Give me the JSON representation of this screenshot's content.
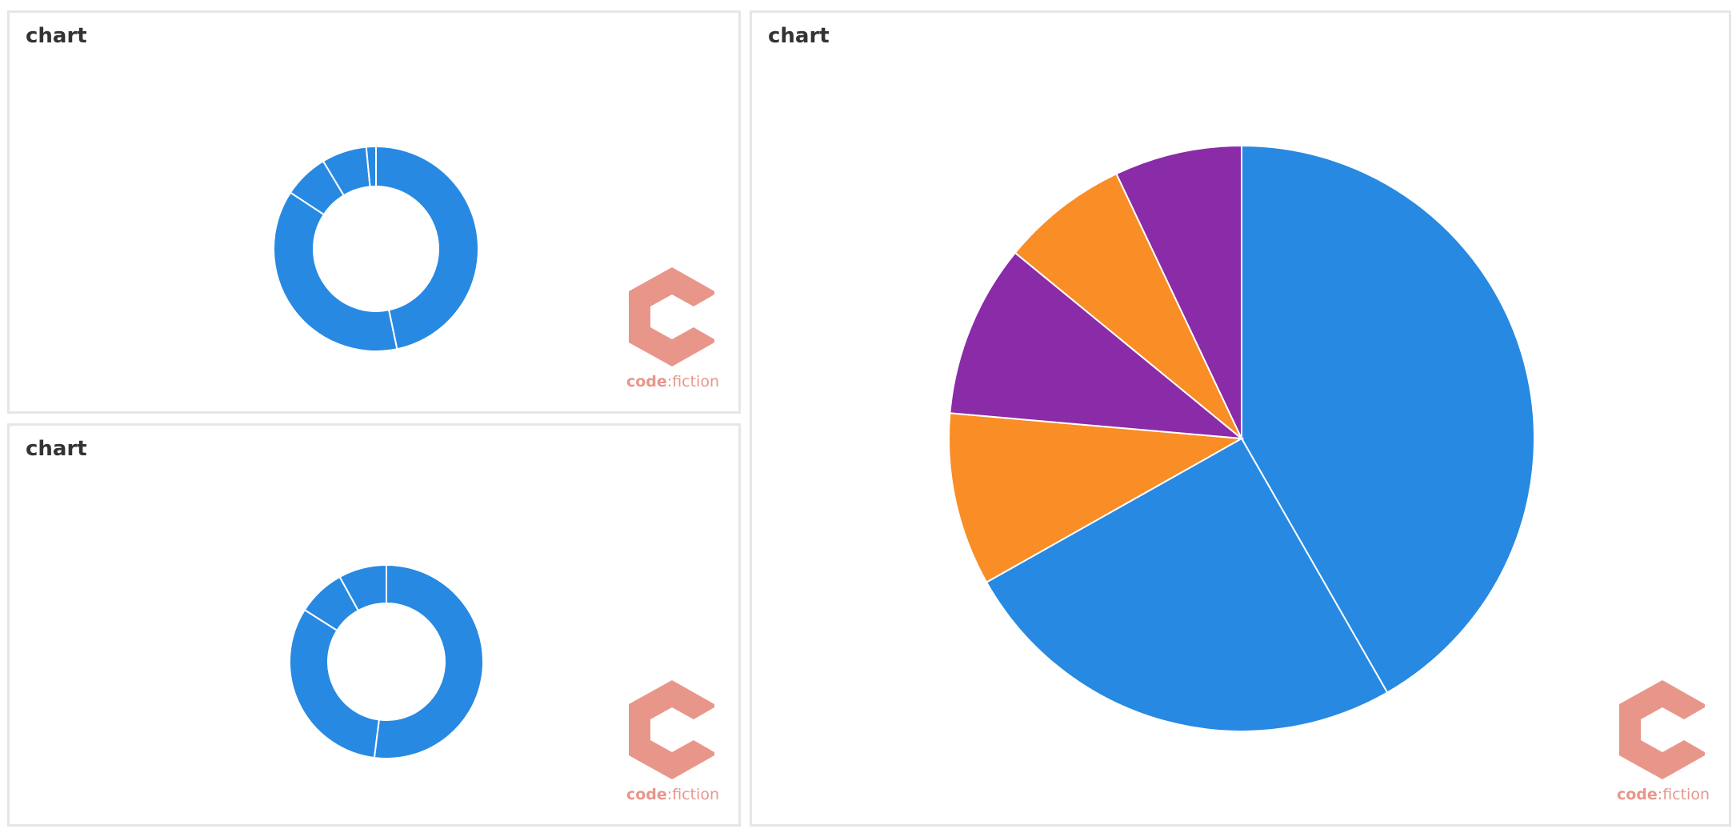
{
  "panels": [
    {
      "title": "chart"
    },
    {
      "title": "chart"
    },
    {
      "title": "chart"
    }
  ],
  "brand": {
    "name_bold": "code",
    "separator": ":",
    "name_light": "fiction",
    "logo_icon": "hexagon-c-logo-icon",
    "color": "#e9968a"
  },
  "colors": {
    "blue": "#2789e2",
    "orange": "#f98d26",
    "purple": "#8a2ba8"
  },
  "chart_data": [
    {
      "type": "pie",
      "donut": true,
      "title": "chart",
      "slices": [
        {
          "value": 46,
          "color": "#2789e2"
        },
        {
          "value": 37,
          "color": "#2789e2"
        },
        {
          "value": 7,
          "color": "#2789e2"
        },
        {
          "value": 7,
          "color": "#2789e2"
        },
        {
          "value": 1.5,
          "color": "#2789e2"
        }
      ]
    },
    {
      "type": "pie",
      "donut": true,
      "title": "chart",
      "slices": [
        {
          "value": 52,
          "color": "#2789e2"
        },
        {
          "value": 32,
          "color": "#2789e2"
        },
        {
          "value": 8,
          "color": "#2789e2"
        },
        {
          "value": 8,
          "color": "#2789e2"
        }
      ]
    },
    {
      "type": "pie",
      "donut": false,
      "title": "chart",
      "slices": [
        {
          "value": 41.5,
          "color": "#2789e2"
        },
        {
          "value": 25,
          "color": "#2789e2"
        },
        {
          "value": 9.5,
          "color": "#f98d26"
        },
        {
          "value": 9.5,
          "color": "#8a2ba8"
        },
        {
          "value": 7,
          "color": "#f98d26"
        },
        {
          "value": 7,
          "color": "#8a2ba8"
        }
      ]
    }
  ]
}
